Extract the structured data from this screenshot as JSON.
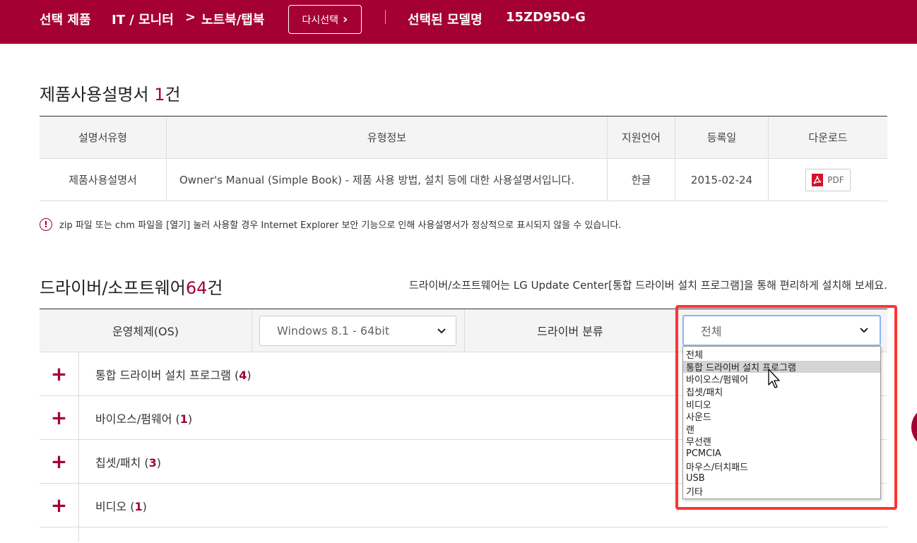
{
  "topbar": {
    "selected_label": "선택 제품",
    "category": "IT / 모니터",
    "separator": ">",
    "subcategory": "노트북/탭북",
    "reselect_label": "다시선택",
    "reselect_chevron": "›",
    "model_label": "선택된 모델명",
    "model_name": "15ZD950-G"
  },
  "manuals": {
    "title": "제품사용설명서",
    "count": "1",
    "count_suffix": "건",
    "headers": [
      "설명서유형",
      "유형정보",
      "지원언어",
      "등록일",
      "다운로드"
    ],
    "rows": [
      {
        "type": "제품사용설명서",
        "info": "Owner's Manual (Simple Book) - 제품 사용 방법, 설치 등에 대한 사용설명서입니다.",
        "language": "한글",
        "date": "2015-02-24",
        "download_label": "PDF",
        "download_icon": "pdf-icon"
      }
    ],
    "notice_icon": "!",
    "notice": "zip 파일 또는 chm 파일을 [열기] 눌러 사용할 경우 Internet Explorer 보안 기능으로 인해 사용설명서가 정상적으로 표시되지 않을 수 있습니다."
  },
  "drivers": {
    "title": "드라이버/소프트웨어",
    "count": "64",
    "count_suffix": "건",
    "note": "드라이버/소프트웨어는 LG Update Center[통합 드라이버 설치 프로그램]을 통해 편리하게 설치해 보세요.",
    "os_label": "운영체제(OS)",
    "os_value": "Windows 8.1 - 64bit",
    "category_label": "드라이버 분류",
    "category_value": "전체",
    "category_options": [
      "전체",
      "통합 드라이버 설치 프로그램",
      "바이오스/펌웨어",
      "칩셋/패치",
      "비디오",
      "사운드",
      "랜",
      "무선랜",
      "PCMCIA",
      "마우스/터치패드",
      "USB",
      "기타"
    ],
    "hovered_option": "통합 드라이버 설치 프로그램",
    "groups": [
      {
        "name": "통합 드라이버 설치 프로그램",
        "count": "4"
      },
      {
        "name": "바이오스/펌웨어",
        "count": "1"
      },
      {
        "name": "칩셋/패치",
        "count": "3"
      },
      {
        "name": "비디오",
        "count": "1"
      }
    ],
    "expand_glyph": "+",
    "select_chevron": "⌄"
  },
  "colors": {
    "brand": "#a50034",
    "highlight": "#ff3333"
  }
}
